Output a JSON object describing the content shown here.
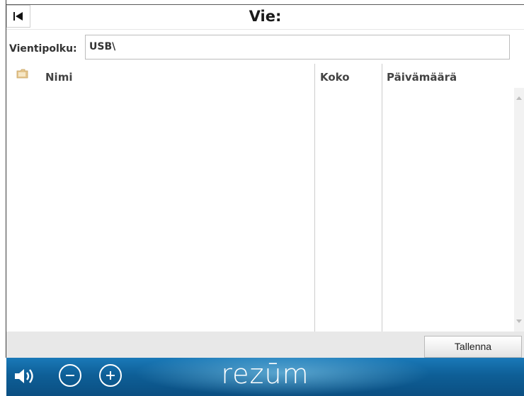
{
  "header": {
    "title": "Vie:",
    "back_icon": "skip-back-icon"
  },
  "path": {
    "label": "Vientipolku:",
    "value": "USB\\"
  },
  "table": {
    "columns": [
      {
        "label": "Nimi",
        "icon": "folder-icon"
      },
      {
        "label": "Koko"
      },
      {
        "label": "Päivämäärä"
      }
    ],
    "rows": []
  },
  "footer": {
    "save_label": "Tallenna"
  },
  "bottom_bar": {
    "brand": "rezūm",
    "speaker_icon": "volume-icon",
    "minus_icon": "minus-icon",
    "plus_icon": "plus-icon"
  },
  "colors": {
    "accent": "#1a79b8",
    "panel": "#e8e8e8"
  }
}
